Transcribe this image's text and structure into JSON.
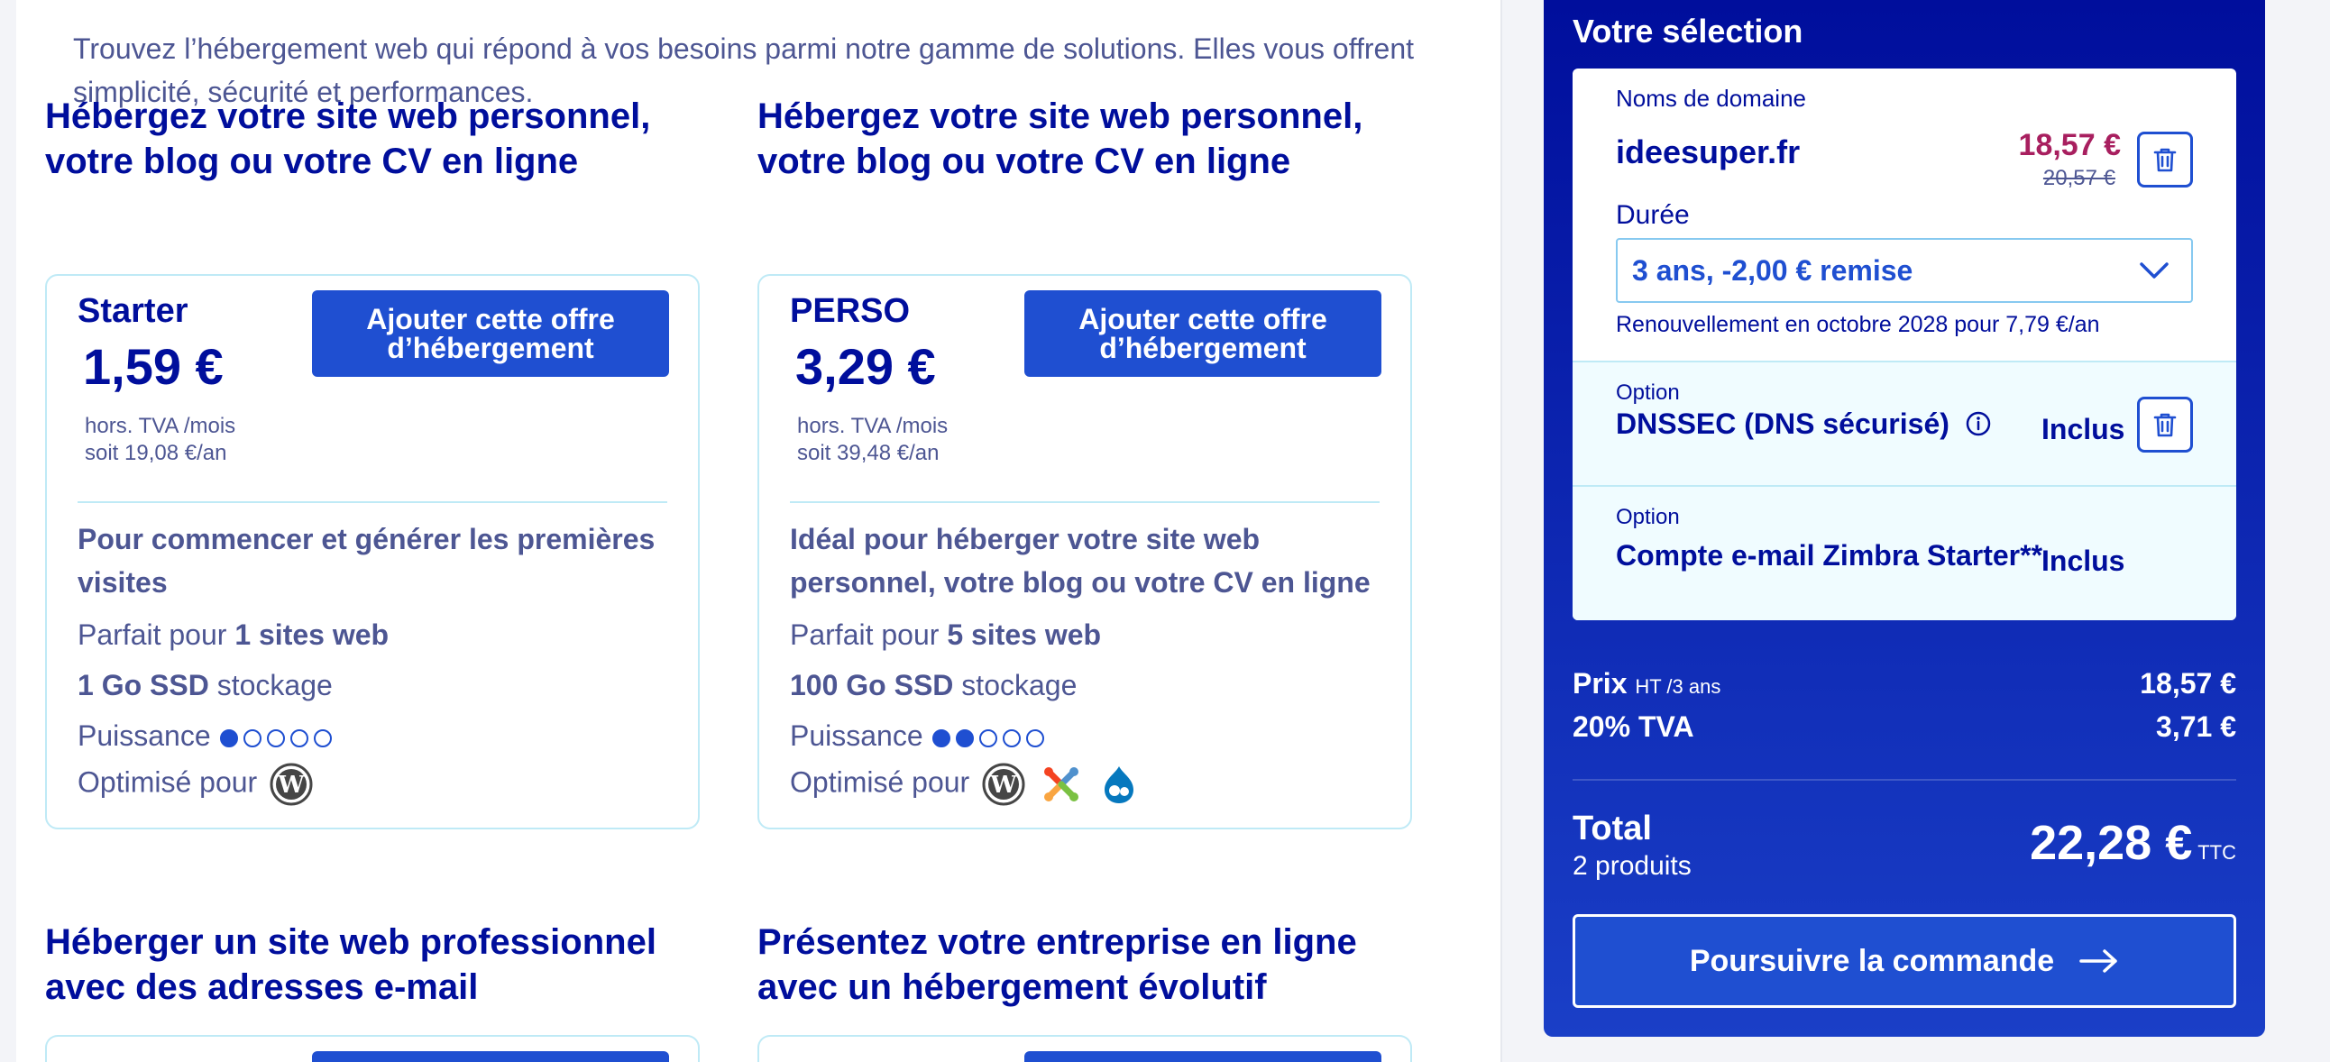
{
  "intro": "Trouvez l’hébergement web qui répond à vos besoins parmi notre gamme de solutions. Elles vous offrent simplicité, sécurité et performances.",
  "offers": [
    {
      "title": "Hébergez votre site web personnel, votre blog ou votre CV en ligne",
      "name": "Starter",
      "price": "1,59 €",
      "tax_line": "hors. TVA /mois",
      "yearly": "soit 19,08 €/an",
      "button_line1": "Ajouter cette offre",
      "button_line2": "d’hébergement",
      "description": "Pour commencer et générer les premières visites",
      "sites_prefix": "Parfait pour ",
      "sites_value": "1 sites web",
      "storage_value": "1 Go SSD",
      "storage_suffix": " stockage",
      "power_label": "Puissance",
      "power_level": 1,
      "optimized_label": "Optimisé pour",
      "cms": [
        "wordpress-icon"
      ]
    },
    {
      "title": "Hébergez votre site web personnel, votre blog ou votre CV en ligne",
      "name": "PERSO",
      "price": "3,29 €",
      "tax_line": "hors. TVA /mois",
      "yearly": "soit 39,48 €/an",
      "button_line1": "Ajouter cette offre",
      "button_line2": "d’hébergement",
      "description": "Idéal pour héberger votre site web personnel, votre blog ou votre CV en ligne",
      "sites_prefix": "Parfait pour ",
      "sites_value": "5 sites web",
      "storage_value": "100 Go SSD",
      "storage_suffix": " stockage",
      "power_label": "Puissance",
      "power_level": 2,
      "optimized_label": "Optimisé pour",
      "cms": [
        "wordpress-icon",
        "joomla-icon",
        "drupal-icon"
      ]
    }
  ],
  "lower_titles": [
    "Héberger un site web professionnel avec des adresses e-mail",
    "Présentez votre entreprise en ligne avec un hébergement évolutif"
  ],
  "panel": {
    "title": "Votre sélection",
    "domain_label": "Noms de domaine",
    "domain": "ideesuper.fr",
    "price": "18,57 €",
    "old_price": "20,57 €",
    "duration_label": "Durée",
    "duration_value": "3 ans, -2,00 € remise",
    "renewal": "Renouvellement en octobre 2028 pour 7,79 €/an",
    "option1_label": "Option",
    "option1_name": "DNSSEC (DNS sécurisé)",
    "option1_status": "Inclus",
    "option2_label": "Option",
    "option2_name": "Compte e-mail Zimbra Starter**",
    "option2_status": "Inclus",
    "price_label": "Prix",
    "price_suffix": "HT /3 ans",
    "price_value": "18,57 €",
    "vat_label": "20% TVA",
    "vat_value": "3,71 €",
    "total_label": "Total",
    "total_count": "2 produits",
    "total_value": "22,28 €",
    "total_suffix": "TTC",
    "cta": "Poursuivre la commande"
  },
  "colors": {
    "navy": "#000e9c",
    "primary": "#1f4fd1",
    "price_accent": "#a81f5f",
    "card_border": "#bfeaf6"
  }
}
